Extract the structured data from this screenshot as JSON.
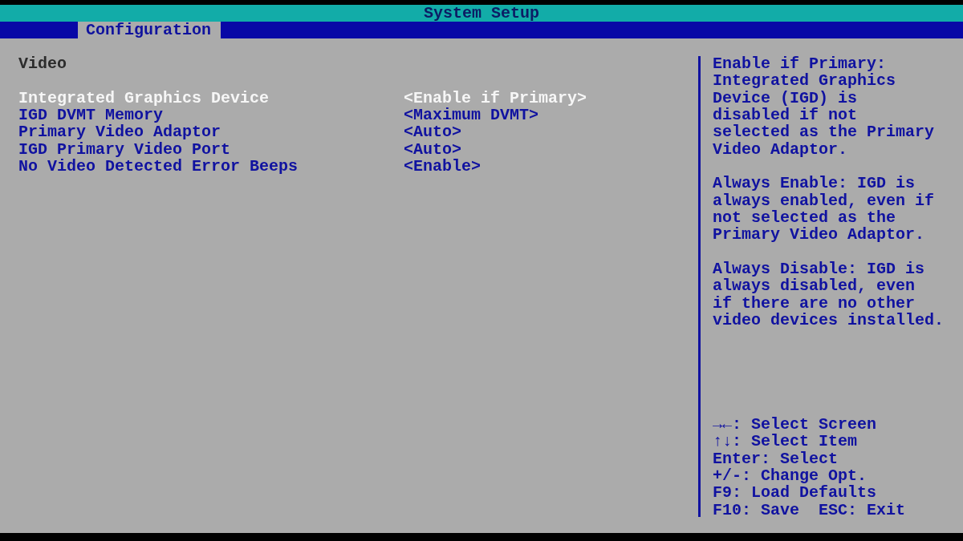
{
  "window": {
    "title": "System Setup"
  },
  "tabs": [
    {
      "label": "Configuration",
      "selected": true
    }
  ],
  "section": {
    "title": "Video"
  },
  "settings": [
    {
      "label": "Integrated Graphics Device",
      "value": "<Enable if Primary>",
      "selected": true
    },
    {
      "label": "IGD DVMT Memory",
      "value": "<Maximum DVMT>",
      "selected": false
    },
    {
      "label": "Primary Video Adaptor",
      "value": "<Auto>",
      "selected": false
    },
    {
      "label": "IGD Primary Video Port",
      "value": "<Auto>",
      "selected": false
    },
    {
      "label": "No Video Detected Error Beeps",
      "value": "<Enable>",
      "selected": false
    }
  ],
  "help": {
    "paragraphs": [
      "Enable if Primary:\nIntegrated Graphics\nDevice (IGD) is\ndisabled if not\nselected as the Primary\nVideo Adaptor.",
      "Always Enable: IGD is\nalways enabled, even if\nnot selected as the\nPrimary Video Adaptor.",
      "Always Disable: IGD is\nalways disabled, even\nif there are no other\nvideo devices installed."
    ]
  },
  "key_legend": [
    "→←: Select Screen",
    "↑↓: Select Item",
    "Enter: Select",
    "+/-: Change Opt.",
    "F9: Load Defaults",
    "F10: Save  ESC: Exit"
  ]
}
